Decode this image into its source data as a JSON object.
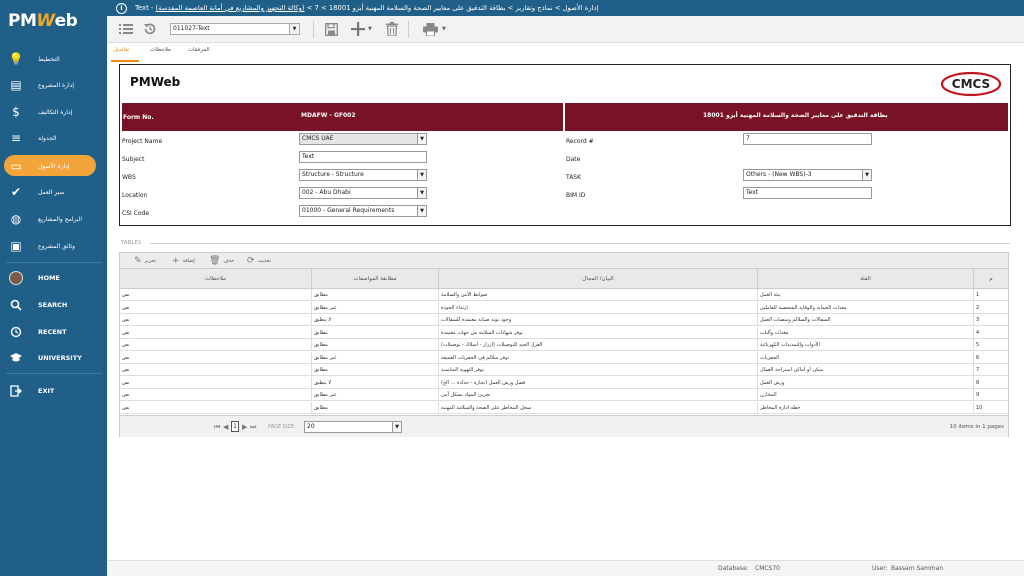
{
  "app": {
    "logo_text": "PM",
    "logo_w": "W",
    "logo_suffix": "eb"
  },
  "sidebar": {
    "items": [
      {
        "label": "التخطيط",
        "icon": "lightbulb-icon",
        "glyph": "💡"
      },
      {
        "label": "إدارة المشروع",
        "icon": "project-icon",
        "glyph": "▤"
      },
      {
        "label": "إدارة التكاليف",
        "icon": "dollar-icon",
        "glyph": "$"
      },
      {
        "label": "الجدولة",
        "icon": "schedule-icon",
        "glyph": "≡"
      },
      {
        "label": "إدارة الأصول",
        "icon": "assets-icon",
        "glyph": "▭"
      },
      {
        "label": "سير العمل",
        "icon": "checkmark-icon",
        "glyph": "✔"
      },
      {
        "label": "البرامج والمشاريع",
        "icon": "globe-icon",
        "glyph": "◍"
      },
      {
        "label": "وثائق المشروع",
        "icon": "briefcase-icon",
        "glyph": "▣"
      }
    ],
    "home": "HOME",
    "search": "SEARCH",
    "recent": "RECENT",
    "university": "UNIVERSITY",
    "exit": "EXIT"
  },
  "topbar": {
    "breadcrumb": "Text - إدارة الأصول > نماذج وتقارير > بطاقة التدقيق على معايير الصحة والسلامة المهنية أيزو 18001 > 7 > ",
    "breadcrumb_link": "(وكالة التجهيز والمشاريع في أمانة العاصمة المقدسة)"
  },
  "toolbar": {
    "record_select": "011027-Text"
  },
  "tabs": [
    {
      "label": "تفاصيل",
      "active": true
    },
    {
      "label": "ملاحظات",
      "active": false
    },
    {
      "label": "المرفقات",
      "active": false
    }
  ],
  "form": {
    "brand_left": "PMWeb",
    "brand_right": "CMCS",
    "form_no_label": "Form No.",
    "form_no_value": "MDAFW - GF002",
    "title": "بطاقة التدقيق على معايير الصحة والسلامة المهنية أيزو 18001",
    "project_name_label": "Project Name",
    "project_name_value": "CMCS UAE",
    "subject_label": "Subject",
    "subject_value": "Text",
    "wbs_label": "WBS",
    "wbs_value": "Structure - Structure",
    "location_label": "Location",
    "location_value": "002 - Abu Dhabi",
    "csi_label": "CSI Code",
    "csi_value": "01000 - General Requirements",
    "record_label": "Record #",
    "record_value": "7",
    "date_label": "Date",
    "task_label": "TASK",
    "task_value": "Others - (New WBS)-3",
    "bim_label": "BIM ID",
    "bim_value": "Text"
  },
  "table": {
    "title": "TABLE1",
    "tools": {
      "edit": "تحرير",
      "add": "إضافة",
      "delete": "حذف",
      "refresh": "تحديث"
    },
    "headers": {
      "notes": "ملاحظات",
      "compliance": "مطابقة المواصفات",
      "item": "البيان/ المجال",
      "category": "الفئة",
      "num": "م"
    },
    "rows": [
      {
        "notes": "نص",
        "compliance": "مطابق",
        "item": "ضوابط الأمن والسلامة",
        "category": "بيئة العمل",
        "num": "1"
      },
      {
        "notes": "نص",
        "compliance": "غير مطابق",
        "item": "ارتداء الخوذة",
        "category": "معدات الحماية والوقاية الشخصية للعاملين",
        "num": "2"
      },
      {
        "notes": "نص",
        "compliance": "لا ينطبق",
        "item": "وجود نوته صيانة معتمدة للسقالات",
        "category": "السقالات والسلالم ومنصات العمل",
        "num": "3"
      },
      {
        "notes": "نص",
        "compliance": "مطابق",
        "item": "توفر شهادات السلامة من جهات معتمدة",
        "category": "معدات وآليات",
        "num": "4"
      },
      {
        "notes": "نص",
        "compliance": "مطابق",
        "item": "العزل الجيد للتوصيلات (ازرار - اسلاك - توصيلات)",
        "category": "الأدوات والتمديدات الكهربائية",
        "num": "5"
      },
      {
        "notes": "نص",
        "compliance": "غير مطابق",
        "item": "توفر سلالم في الحفريات العميقة",
        "category": "الحفريات",
        "num": "6"
      },
      {
        "notes": "نص",
        "compliance": "مطابق",
        "item": "توفر التهوية المناسبة",
        "category": "سكن أو أماكن استراحة العمال",
        "num": "7"
      },
      {
        "notes": "نص",
        "compliance": "لا ينطبق",
        "item": "فصل ورش العمل (نجارة - حدادة ... الخ)",
        "category": "ورش العمل",
        "num": "8"
      },
      {
        "notes": "نص",
        "compliance": "غير مطابق",
        "item": "تخزين المواد بشكل آمن",
        "category": "المخازن",
        "num": "9"
      },
      {
        "notes": "نص",
        "compliance": "مطابق",
        "item": "سجل المخاطر على الصحة والسلامة المهنية",
        "category": "خطة ادارة المخاطر",
        "num": "10"
      }
    ],
    "pager": {
      "page": "1",
      "page_size_label": "PAGE SIZE:",
      "page_size": "20",
      "summary": "10 items in 1 pages"
    }
  },
  "footer": {
    "database_label": "Database:",
    "database_value": "CMCS70",
    "user_label": "User:",
    "user_value": "Bassam Samman"
  }
}
